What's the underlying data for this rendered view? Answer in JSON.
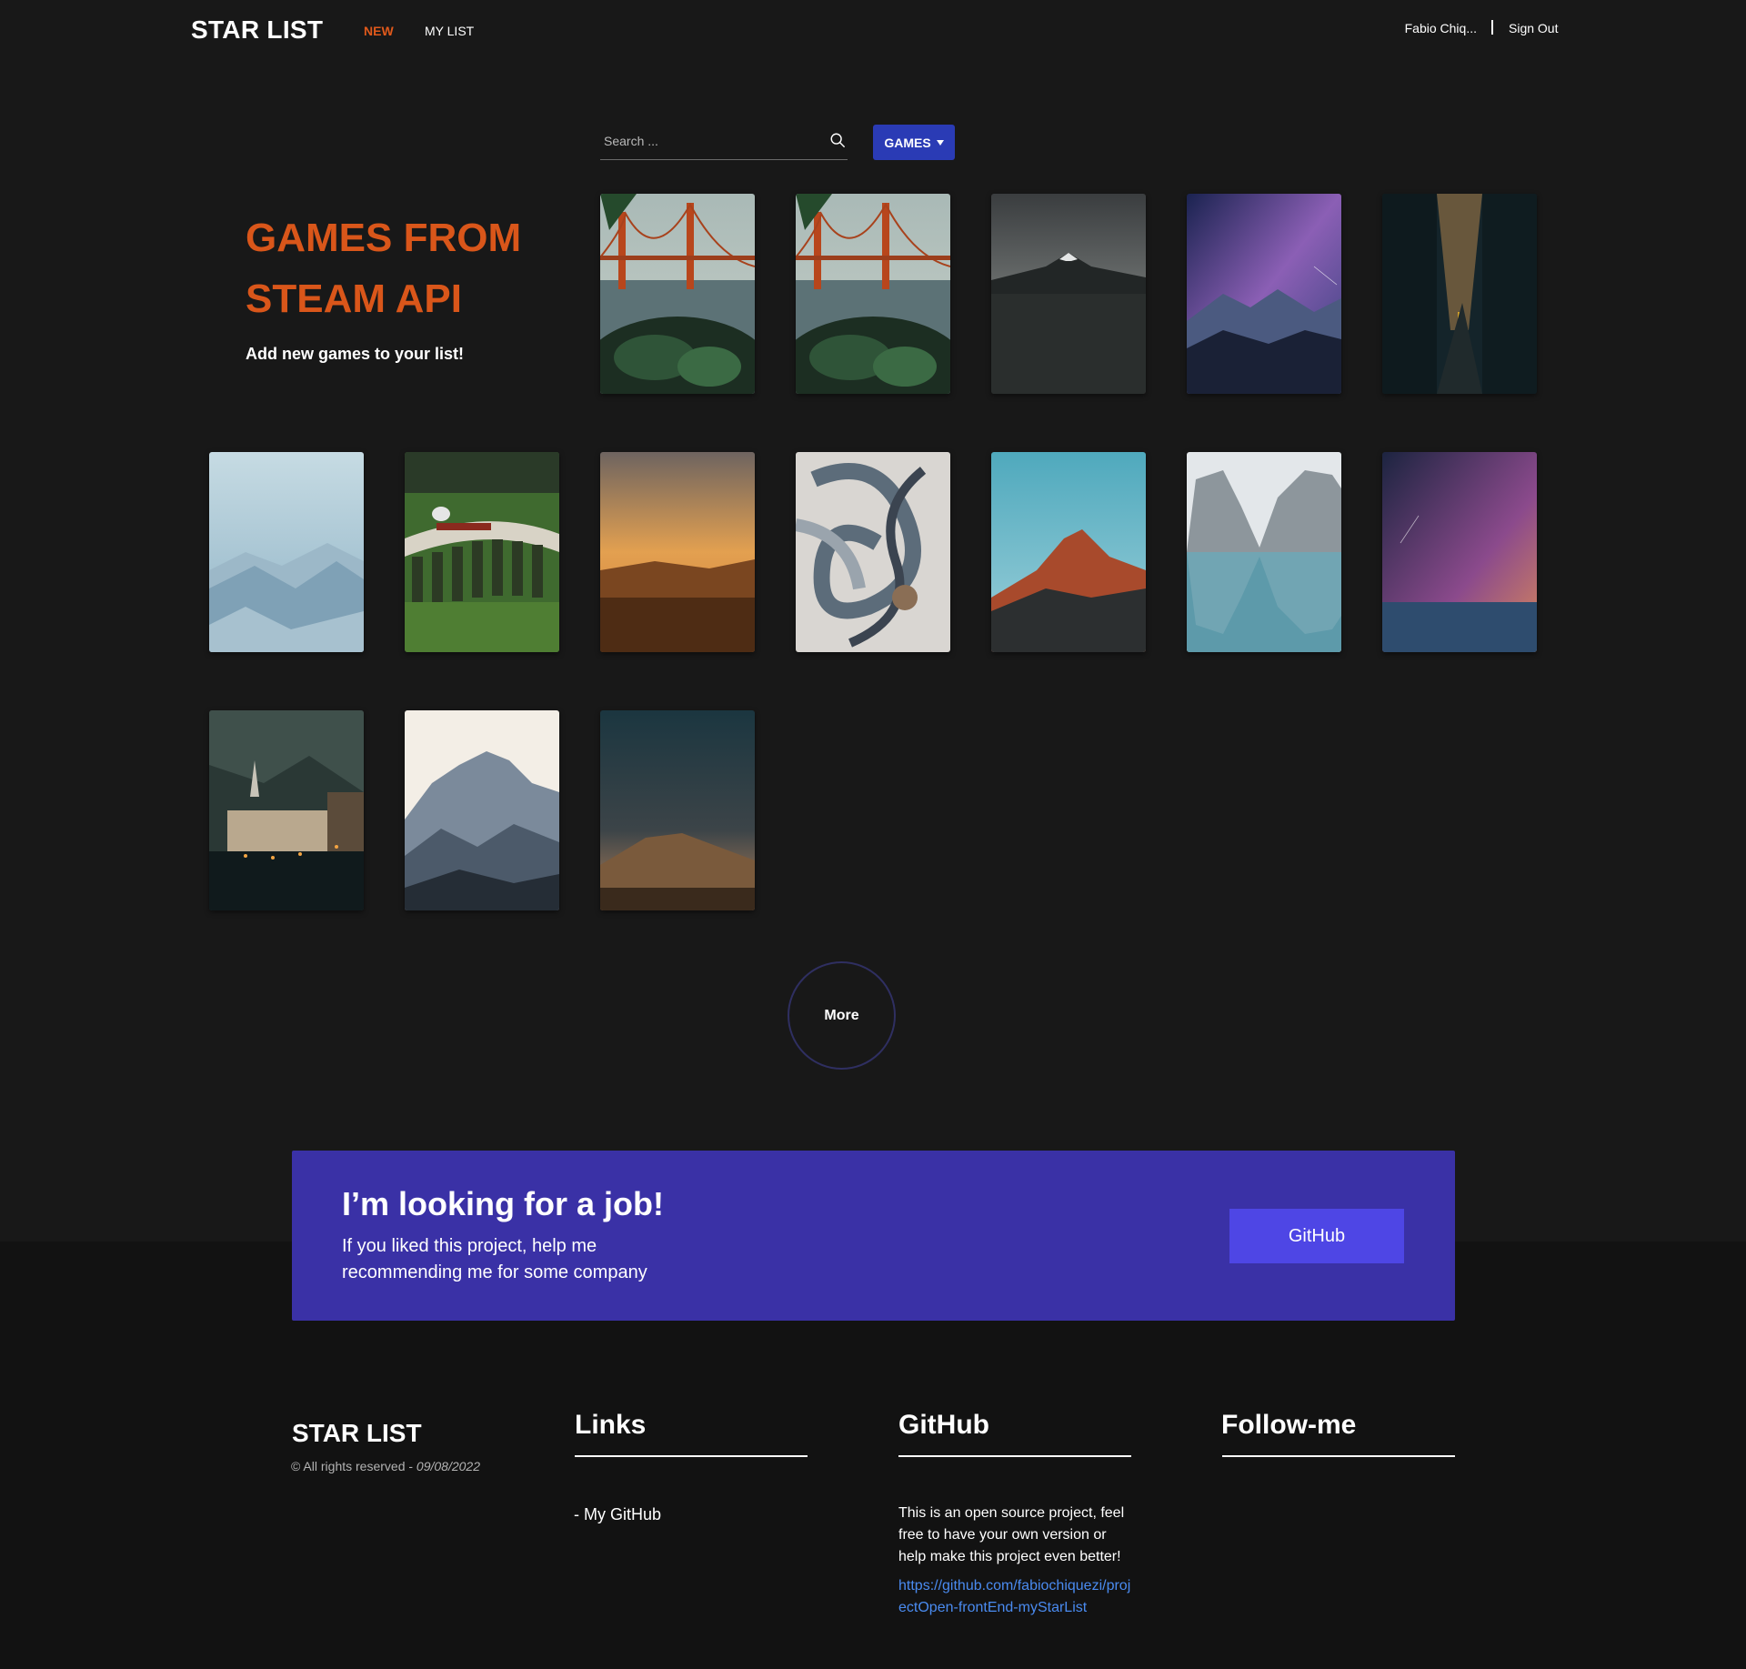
{
  "header": {
    "logo": "STAR LIST",
    "nav": {
      "new": "NEW",
      "my_list": "MY LIST"
    },
    "user_name": "Fabio Chiq...",
    "sign_out": "Sign Out"
  },
  "search": {
    "placeholder": "Search ...",
    "value": ""
  },
  "filter": {
    "label": "GAMES"
  },
  "hero": {
    "title": "GAMES FROM STEAM API",
    "subtitle": "Add new games to your list!"
  },
  "more": {
    "label": "More"
  },
  "job": {
    "title": "I’m looking for a job!",
    "text": "If you liked this project, help me recommending me for some company",
    "button": "GitHub"
  },
  "footer": {
    "logo": "STAR LIST",
    "rights": "© All rights reserved - ",
    "date": "09/08/2022",
    "links_heading": "Links",
    "links": [
      "- My GitHub"
    ],
    "github_heading": "GitHub",
    "github_text": "This is an open source project, feel free to have your own version or help make this project even better!",
    "github_url": "https://github.com/fabiochiquezi/projectOpen-frontEnd-myStarList",
    "follow_heading": "Follow-me"
  },
  "colors": {
    "background": "#181818",
    "accent": "#d9561a",
    "button_blue": "#2a3bb5",
    "banner": "#3a31a6",
    "banner_button": "#4e46e5",
    "link": "#4a8bf0"
  }
}
